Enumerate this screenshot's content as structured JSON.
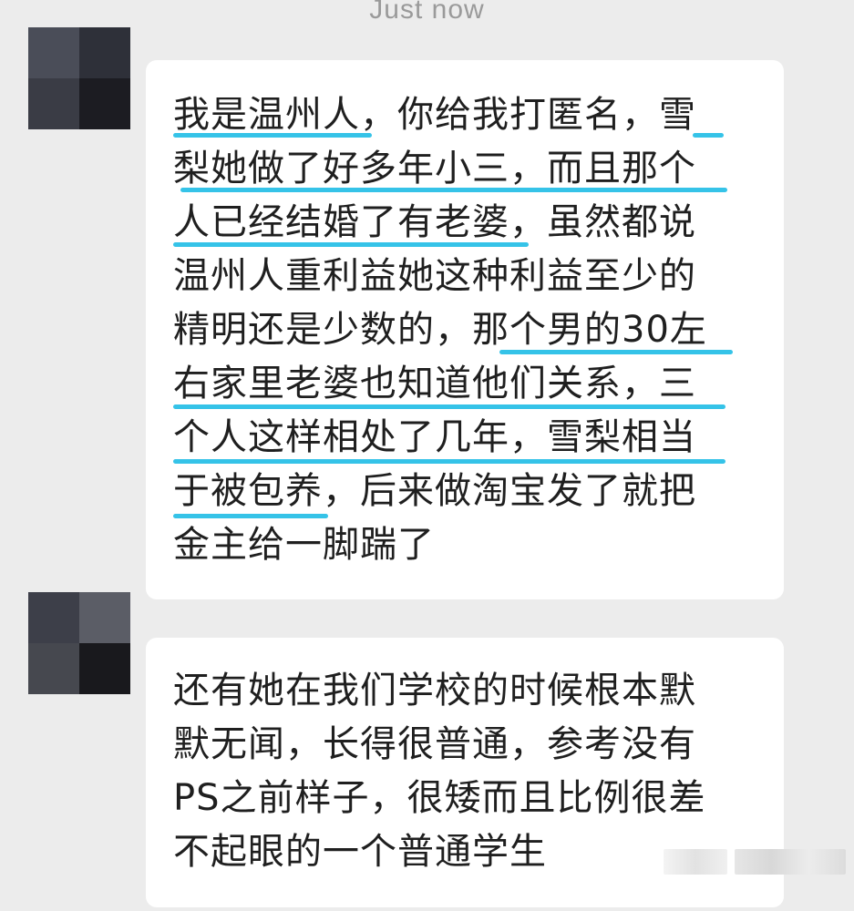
{
  "chat": {
    "timestamp": "Just now",
    "messages": [
      {
        "lines": [
          "我是温州人，你给我打匿名，雪",
          "梨她做了好多年小三，而且那个",
          "人已经结婚了有老婆，虽然都说",
          "温州人重利益她这种利益至少的",
          "精明还是少数的，那个男的30左",
          "右家里老婆也知道他们关系，三",
          "个人这样相处了几年，雪梨相当",
          "于被包养，后来做淘宝发了就把",
          "金主给一脚踹了"
        ]
      },
      {
        "lines": [
          "还有她在我们学校的时候根本默",
          "默无闻，长得很普通，参考没有",
          "PS之前样子，很矮而且比例很差",
          "不起眼的一个普通学生"
        ]
      }
    ]
  },
  "colors": {
    "highlight": "#35c3e8",
    "background": "#ececec",
    "bubble": "#ffffff",
    "text": "#1f1f1f",
    "timestamp": "#9a9a9a"
  }
}
